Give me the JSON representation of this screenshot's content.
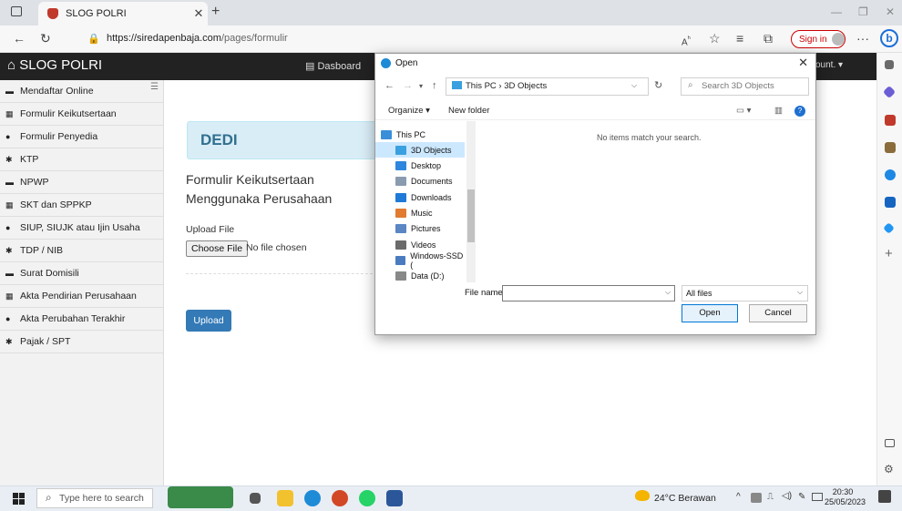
{
  "browser": {
    "tab_title": "SLOG POLRI",
    "url_host": "https://siredapenbaja.com",
    "url_path": "/pages/formulir",
    "sign_in": "Sign in"
  },
  "site": {
    "brand": "SLOG POLRI",
    "nav_dashboard": "Dasboard",
    "nav_account": "ount."
  },
  "sidebar": {
    "items": [
      {
        "label": "Mendaftar Online",
        "icon": "inbox-icon"
      },
      {
        "label": "Formulir Keikutsertaan",
        "icon": "grid-icon"
      },
      {
        "label": "Formulir Penyedia",
        "icon": "user-icon"
      },
      {
        "label": "KTP",
        "icon": "cog-icon"
      },
      {
        "label": "NPWP",
        "icon": "inbox-icon"
      },
      {
        "label": "SKT dan SPPKP",
        "icon": "grid-icon"
      },
      {
        "label": "SIUP, SIUJK atau Ijin Usaha",
        "icon": "user-icon"
      },
      {
        "label": "TDP / NIB",
        "icon": "cog-icon"
      },
      {
        "label": "Surat Domisili",
        "icon": "inbox-icon"
      },
      {
        "label": "Akta Pendirian Perusahaan",
        "icon": "grid-icon"
      },
      {
        "label": "Akta Perubahan Terakhir",
        "icon": "user-icon"
      },
      {
        "label": "Pajak / SPT",
        "icon": "cog-icon"
      }
    ]
  },
  "main": {
    "name": "DEDI",
    "form_title": "Formulir Keikutsertaan Menggunaka Perusahaan",
    "upload_label": "Upload File",
    "choose_file": "Choose File",
    "no_file": "No file chosen",
    "upload_button": "Upload"
  },
  "dialog": {
    "title": "Open",
    "path": "This PC  ›  3D Objects",
    "search_placeholder": "Search 3D Objects",
    "organize": "Organize ▾",
    "new_folder": "New folder",
    "empty_message": "No items match your search.",
    "tree": [
      {
        "label": "This PC",
        "color": "#3a8fd9"
      },
      {
        "label": "3D Objects",
        "color": "#3aa0e0"
      },
      {
        "label": "Desktop",
        "color": "#2e86de"
      },
      {
        "label": "Documents",
        "color": "#8a9bb0"
      },
      {
        "label": "Downloads",
        "color": "#1e7ad6"
      },
      {
        "label": "Music",
        "color": "#e07b2f"
      },
      {
        "label": "Pictures",
        "color": "#5a86c4"
      },
      {
        "label": "Videos",
        "color": "#6b6b6b"
      },
      {
        "label": "Windows-SSD (",
        "color": "#4a7bc0"
      },
      {
        "label": "Data (D:)",
        "color": "#888888"
      }
    ],
    "file_name_label": "File name:",
    "file_name_value": "",
    "filter": "All files",
    "open_button": "Open",
    "cancel_button": "Cancel"
  },
  "taskbar": {
    "search_placeholder": "Type here to search",
    "weather": "24°C  Berawan",
    "time": "20:30",
    "date": "25/05/2023"
  }
}
